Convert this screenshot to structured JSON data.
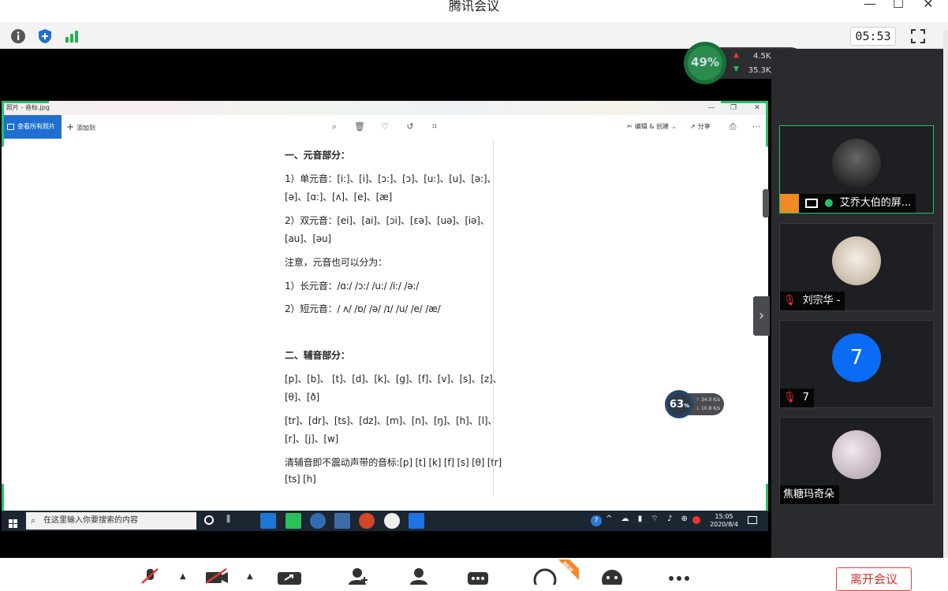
{
  "window": {
    "title": "腾讯会议",
    "controls": [
      "—",
      "☐",
      "✕"
    ]
  },
  "toolbar": {
    "icons": [
      "info-icon",
      "shield-icon",
      "signal-icon",
      "fullscreen-icon"
    ],
    "timer": "05:53"
  },
  "network_top": {
    "cpu": "49%",
    "upload": "4.5K/s",
    "download": "35.3K/s"
  },
  "viewer": {
    "title": "照片 - 音标.jpg",
    "all_photos": "查看所有照片",
    "add": "添加到",
    "edit": "编辑 & 创建",
    "share": "分享",
    "min": "—",
    "max": "❐",
    "close": "✕"
  },
  "doc": {
    "lines": [
      "一、元音部分：",
      "1）单元音：[i:]、[i]、[ɔ:]、[ɔ]、[u:]、[u]、[ə:]、",
      "[ə]、[ɑ:]、[ʌ]、[e]、[æ]",
      "2）双元音：[ei]、[ai]、[ɔi]、[ɛə]、[uə]、[iə]、",
      "[au]、[əu]",
      "注意，元音也可以分为：",
      "1）长元音：/ɑ:/ /ɔ:/ /u:/ /i:/ /ə:/",
      "2）短元音：/ ʌ/ /ɒ/ /ə/ /ɪ/ /u/ /e/ /æ/",
      "二、辅音部分：",
      "[p]、[b]、 [t]、[d]、[k]、[g]、[f]、[v]、[s]、[z]、",
      "[θ]、[ð]",
      "[tr]、[dr]、[ts]、[dz]、[m]、[n]、[ŋ]、[h]、[l]、",
      "[r]、[j]、[w]",
      "清辅音即不震动声带的音标:[p] [t] [k] [f] [s] [θ] [tr]",
      "[ts] [h]"
    ]
  },
  "network_mid": {
    "cpu": "63",
    "unit": "%",
    "upload": "34.0 K/s",
    "download": "10.8 K/s"
  },
  "taskbar": {
    "search_placeholder": "在这里输入你要搜索的内容",
    "time": "15:05",
    "date": "2020/8/4"
  },
  "participants": [
    {
      "name": "艾乔大伯的屏...",
      "active": true,
      "muted": false,
      "sharing": true
    },
    {
      "name": "刘宗华 -",
      "active": false,
      "muted": true
    },
    {
      "name": "7",
      "avatar_text": "7",
      "active": false,
      "muted": true
    },
    {
      "name": "焦糖玛奇朵",
      "active": false,
      "muted": false
    }
  ],
  "bottombar": {
    "leave": "离开会议",
    "new_badge": "NEW"
  },
  "colors": {
    "accent_green": "#1ec46b",
    "accent_blue": "#1f6fd1",
    "leave_red": "#d63030",
    "avatar_blue": "#0a6bf5"
  }
}
